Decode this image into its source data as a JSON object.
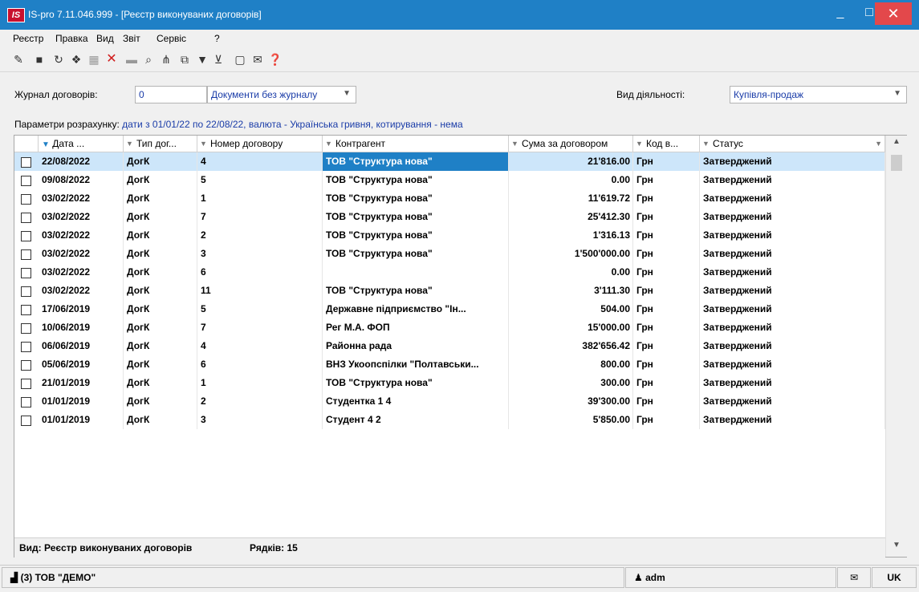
{
  "window": {
    "logo": "IS",
    "title": "IS-pro 7.11.046.999 - [Реєстр виконуваних договорів]",
    "minimize": "_",
    "maximize": "□",
    "close": "✕"
  },
  "menu": [
    "Реєстр",
    "Правка",
    "Вид",
    "Звіт",
    "Сервіс",
    "?"
  ],
  "toolbar_icons": [
    "new-doc-icon",
    "print-icon",
    "refresh-icon",
    "copy-icon",
    "grid-icon",
    "delete-icon",
    "tile-icon",
    "search-icon",
    "tree-icon",
    "link-icon",
    "filter-icon",
    "clear-filter-icon",
    "form-icon",
    "mail-icon",
    "help-icon"
  ],
  "filters": {
    "journal_label": "Журнал договорів:",
    "journal_code": "0",
    "journal_name": "Документи без журналу",
    "activity_label": "Вид діяльності:",
    "activity_value": "Купівля-продаж",
    "params_label": "Параметри розрахунку:",
    "params_value": "дати з 01/01/22 по 22/08/22, валюта - Українська гривня, котирування - нема"
  },
  "columns": [
    "Дата ...",
    "Тип дог...",
    "Номер договору",
    "Контрагент",
    "Сума за договором",
    "Код в...",
    "Статус"
  ],
  "rows": [
    {
      "date": "22/08/2022",
      "type": "ДогК",
      "number": "4",
      "counterparty": "ТОВ \"Структура нова\"",
      "amount": "21'816.00",
      "currency": "Грн",
      "status": "Затверджений"
    },
    {
      "date": "09/08/2022",
      "type": "ДогК",
      "number": "5",
      "counterparty": "ТОВ \"Структура нова\"",
      "amount": "0.00",
      "currency": "Грн",
      "status": "Затверджений"
    },
    {
      "date": "03/02/2022",
      "type": "ДогК",
      "number": "1",
      "counterparty": "ТОВ \"Структура нова\"",
      "amount": "11'619.72",
      "currency": "Грн",
      "status": "Затверджений"
    },
    {
      "date": "03/02/2022",
      "type": "ДогК",
      "number": "7",
      "counterparty": "ТОВ \"Структура нова\"",
      "amount": "25'412.30",
      "currency": "Грн",
      "status": "Затверджений"
    },
    {
      "date": "03/02/2022",
      "type": "ДогК",
      "number": "2",
      "counterparty": "ТОВ \"Структура нова\"",
      "amount": "1'316.13",
      "currency": "Грн",
      "status": "Затверджений"
    },
    {
      "date": "03/02/2022",
      "type": "ДогК",
      "number": "3",
      "counterparty": "ТОВ \"Структура нова\"",
      "amount": "1'500'000.00",
      "currency": "Грн",
      "status": "Затверджений"
    },
    {
      "date": "03/02/2022",
      "type": "ДогК",
      "number": "6",
      "counterparty": "",
      "amount": "0.00",
      "currency": "Грн",
      "status": "Затверджений"
    },
    {
      "date": "03/02/2022",
      "type": "ДогК",
      "number": "11",
      "counterparty": "ТОВ \"Структура нова\"",
      "amount": "3'111.30",
      "currency": "Грн",
      "status": "Затверджений"
    },
    {
      "date": "17/06/2019",
      "type": "ДогК",
      "number": "5",
      "counterparty": "Державне підприємство \"Ін...",
      "amount": "504.00",
      "currency": "Грн",
      "status": "Затверджений"
    },
    {
      "date": "10/06/2019",
      "type": "ДогК",
      "number": "7",
      "counterparty": "Рег М.А. ФОП",
      "amount": "15'000.00",
      "currency": "Грн",
      "status": "Затверджений"
    },
    {
      "date": "06/06/2019",
      "type": "ДогК",
      "number": "4",
      "counterparty": "Районна рада",
      "amount": "382'656.42",
      "currency": "Грн",
      "status": "Затверджений"
    },
    {
      "date": "05/06/2019",
      "type": "ДогК",
      "number": "6",
      "counterparty": "ВНЗ Укоопспілки \"Полтавськи...",
      "amount": "800.00",
      "currency": "Грн",
      "status": "Затверджений"
    },
    {
      "date": "21/01/2019",
      "type": "ДогК",
      "number": "1",
      "counterparty": "ТОВ \"Структура нова\"",
      "amount": "300.00",
      "currency": "Грн",
      "status": "Затверджений"
    },
    {
      "date": "01/01/2019",
      "type": "ДогК",
      "number": "2",
      "counterparty": "Студентка 1 4",
      "amount": "39'300.00",
      "currency": "Грн",
      "status": "Затверджений"
    },
    {
      "date": "01/01/2019",
      "type": "ДогК",
      "number": "3",
      "counterparty": "Студент 4 2",
      "amount": "5'850.00",
      "currency": "Грн",
      "status": "Затверджений"
    }
  ],
  "footer": {
    "view": "Вид: Реєстр виконуваних договорів",
    "rows_count": "Рядків: 15"
  },
  "statusbar": {
    "company": "(3) ТОВ \"ДЕМО\"",
    "user": "adm",
    "lang": "UK"
  }
}
